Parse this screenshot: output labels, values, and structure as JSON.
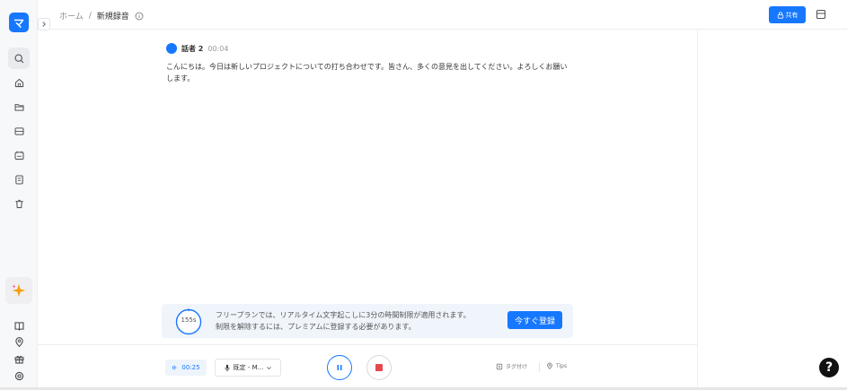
{
  "sidebar": {
    "logo_glyph": "マ",
    "items": [
      {
        "icon": "search-icon"
      },
      {
        "icon": "home-icon"
      },
      {
        "icon": "folder-icon"
      },
      {
        "icon": "inbox-icon"
      },
      {
        "icon": "calendar-icon"
      },
      {
        "icon": "document-icon"
      },
      {
        "icon": "trash-icon"
      }
    ],
    "bottom_items": [
      {
        "icon": "sparkle-icon"
      },
      {
        "icon": "book-icon"
      },
      {
        "icon": "location-icon"
      },
      {
        "icon": "gift-icon"
      },
      {
        "icon": "settings-icon"
      }
    ]
  },
  "header": {
    "breadcrumb_home": "ホーム",
    "breadcrumb_sep": "/",
    "breadcrumb_current": "新規録音",
    "share_label": "共有"
  },
  "transcript": {
    "speaker": "話者 2",
    "time": "00:04",
    "text": "こんにちは。今日は新しいプロジェクトについての打ち合わせです。皆さん、多くの意見を出してください。よろしくお願いします。"
  },
  "banner": {
    "timer": "155s",
    "line1": "フリープランでは、リアルタイム文字起こしに3分の時間制限が適用されます。",
    "line2": "制限を解除するには、プレミアムに登録する必要があります。",
    "register_label": "今すぐ登録"
  },
  "controls": {
    "elapsed": "00:25",
    "mic_label": "既定 - M...",
    "tag_label": "タグ付け",
    "tips_label": "Tips"
  },
  "help_label": "?",
  "colors": {
    "accent": "#1677ff",
    "stop": "#e5484d"
  }
}
